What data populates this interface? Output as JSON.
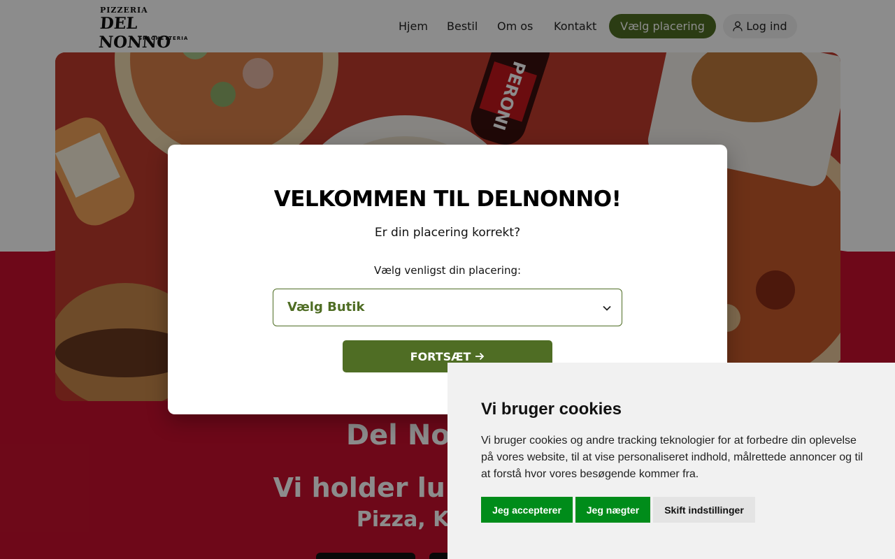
{
  "header": {
    "logo": {
      "line1": "PIZZERIA",
      "line2": "DEL NONNO",
      "line3": "SPAGHETTERIA"
    },
    "nav": [
      "Hjem",
      "Bestil",
      "Om os",
      "Kontakt"
    ],
    "place_button": "Vælg placering",
    "login_button": "Log ind",
    "colors": {
      "accent": "#4f6d24"
    }
  },
  "hero": {
    "title": "Del Nonno Pi",
    "closed_notice": "Vi holder lukket fra der",
    "subtitle": "Pizza, Kebab, B",
    "colors": {
      "background": "#c8102e"
    }
  },
  "modal": {
    "title": "VELKOMMEN TIL DELNONNO!",
    "question": "Er din placering korrekt?",
    "select_label": "Vælg venligst din placering:",
    "select_value": "Vælg Butik",
    "continue_label": "FORTSÆT"
  },
  "cookie_banner": {
    "title": "Vi bruger cookies",
    "text": "Vi bruger cookies og andre tracking teknologier for at forbedre din oplevelse på vores website, til at vise personaliseret indhold, målrettede annoncer og til at forstå hvor vores besøgende kommer fra.",
    "accept_label": "Jeg accepterer",
    "deny_label": "Jeg nægter",
    "settings_label": "Skift indstillinger",
    "colors": {
      "button": "#008c1a"
    }
  }
}
